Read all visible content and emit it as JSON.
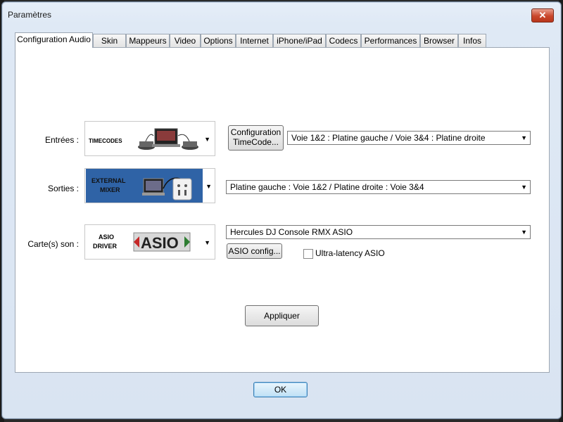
{
  "window": {
    "title": "Paramètres",
    "close_glyph": "✕"
  },
  "tabs": [
    {
      "label": "Configuration Audio",
      "active": true
    },
    {
      "label": "Skin"
    },
    {
      "label": "Mappeurs"
    },
    {
      "label": "Video"
    },
    {
      "label": "Options"
    },
    {
      "label": "Internet"
    },
    {
      "label": "iPhone/iPad"
    },
    {
      "label": "Codecs"
    },
    {
      "label": "Performances"
    },
    {
      "label": "Browser"
    },
    {
      "label": "Infos"
    }
  ],
  "entrees": {
    "label": "Entrées :",
    "image_text": "TIMECODES",
    "config_button_line1": "Configuration",
    "config_button_line2": "TimeCode...",
    "routing_value": "Voie 1&2 : Platine gauche / Voie 3&4 : Platine droite"
  },
  "sorties": {
    "label": "Sorties :",
    "image_line1": "EXTERNAL",
    "image_line2": "MIXER",
    "routing_value": "Platine gauche : Voie 1&2 / Platine droite : Voie 3&4"
  },
  "carte_son": {
    "label": "Carte(s) son :",
    "image_line1": "ASIO",
    "image_line2": "DRIVER",
    "image_logo": "ASIO",
    "device_value": "Hercules DJ Console RMX ASIO",
    "asio_config_button": "ASIO config...",
    "ultra_latency_label": "Ultra-latency ASIO",
    "ultra_latency_checked": false
  },
  "apply_button": "Appliquer",
  "ok_button": "OK"
}
